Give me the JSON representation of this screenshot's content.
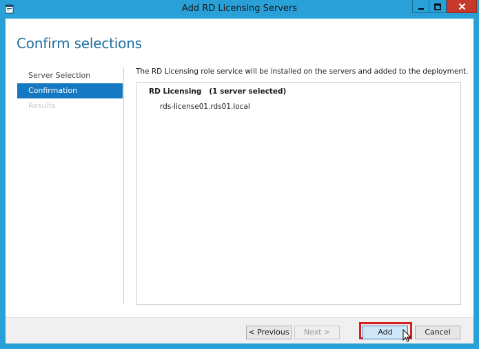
{
  "window": {
    "title": "Add RD Licensing Servers"
  },
  "heading": "Confirm selections",
  "nav": {
    "items": [
      {
        "label": "Server Selection",
        "state": "normal"
      },
      {
        "label": "Confirmation",
        "state": "active"
      },
      {
        "label": "Results",
        "state": "disabled"
      }
    ]
  },
  "content": {
    "description": "The RD Licensing role service will be installed on the servers and added to the deployment.",
    "panel_header": "RD Licensing   (1 server selected)",
    "servers": [
      "rds-license01.rds01.local"
    ]
  },
  "footer": {
    "previous_label": "< Previous",
    "next_label": "Next >",
    "add_label": "Add",
    "cancel_label": "Cancel"
  },
  "colors": {
    "titlebar": "#29a0d8",
    "accent": "#1479c0",
    "heading": "#1f6e9e",
    "close_button": "#c7392b",
    "highlight": "#d42020"
  },
  "icons": [
    "app-window-icon",
    "minimize-icon",
    "maximize-icon",
    "close-icon",
    "mouse-cursor-icon"
  ]
}
